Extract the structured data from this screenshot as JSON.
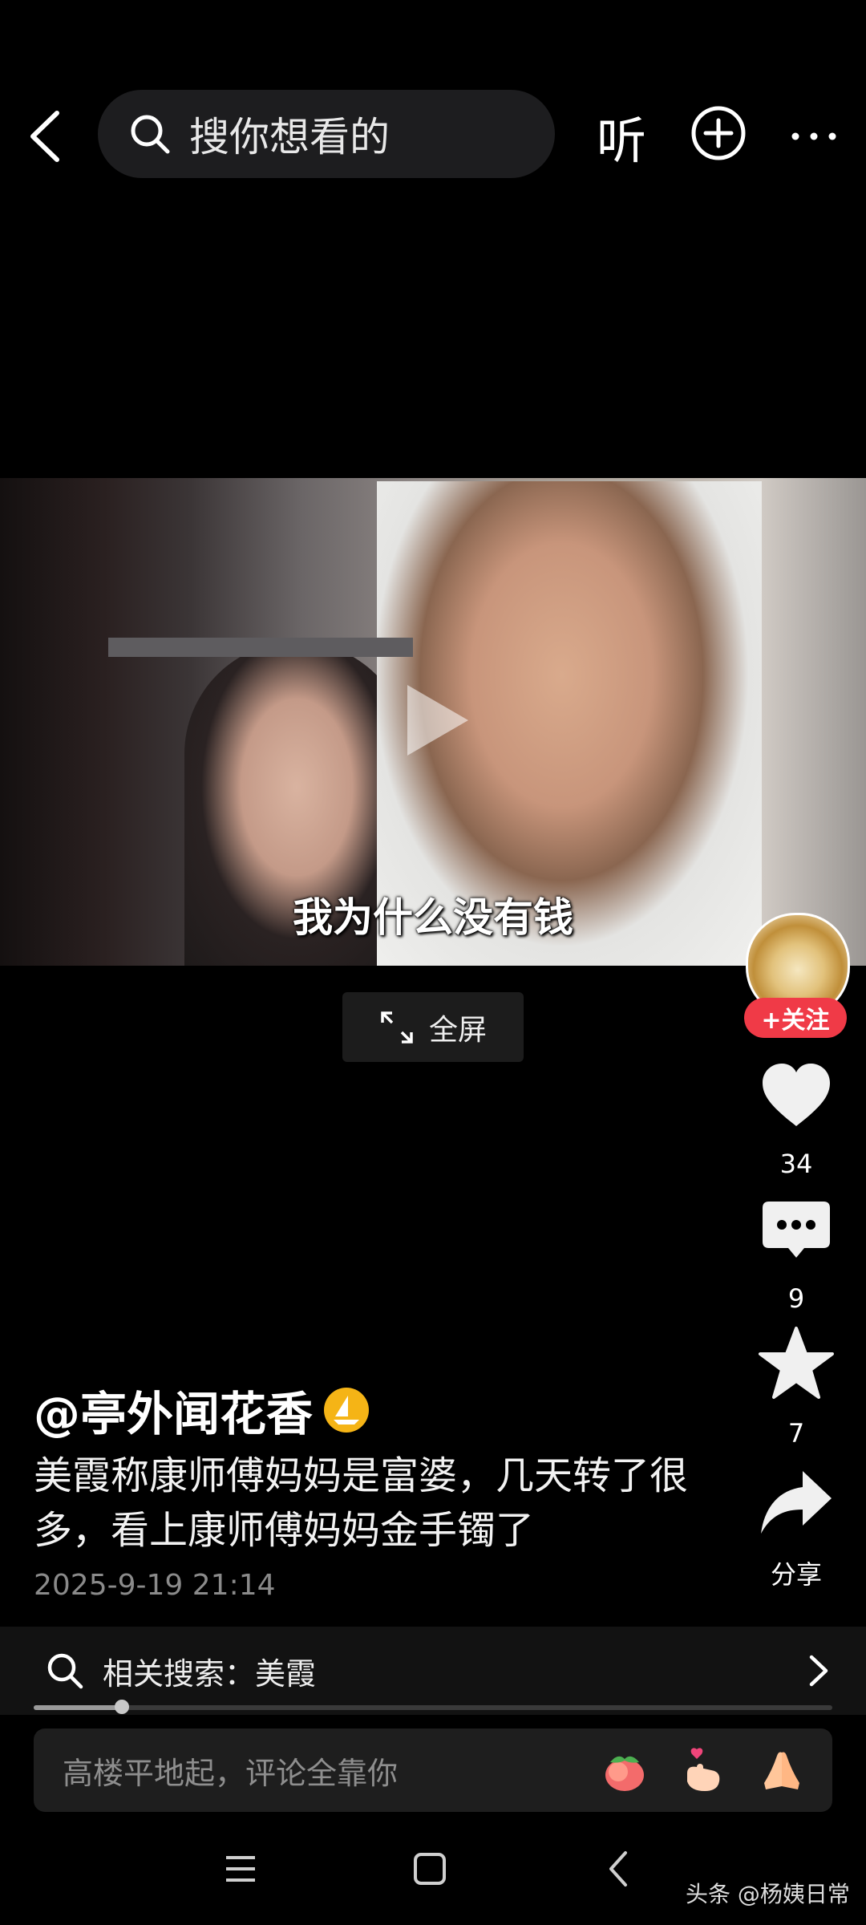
{
  "top_bar": {
    "search_placeholder": "搜你想看的",
    "listen_label": "听"
  },
  "video": {
    "subtitle": "我为什么没有钱",
    "fullscreen_label": "全屏"
  },
  "side_rail": {
    "follow_label": "+关注",
    "like_count": "34",
    "comment_count": "9",
    "favorite_count": "7",
    "share_label": "分享"
  },
  "post": {
    "author": "@亭外闻花香",
    "description": "美霞称康师傅妈妈是富婆，几天转了很多，看上康师傅妈妈金手镯了",
    "timestamp": "2025-9-19 21:14"
  },
  "related_search": {
    "label": "相关搜索：美霞"
  },
  "playback": {
    "progress_fraction": 0.11
  },
  "comment_input": {
    "placeholder": "高楼平地起，评论全靠你"
  },
  "watermark": "头条 @杨姨日常",
  "colors": {
    "accent_red": "#f03a47",
    "background": "#000000",
    "badge_gold": "#f5b416"
  }
}
